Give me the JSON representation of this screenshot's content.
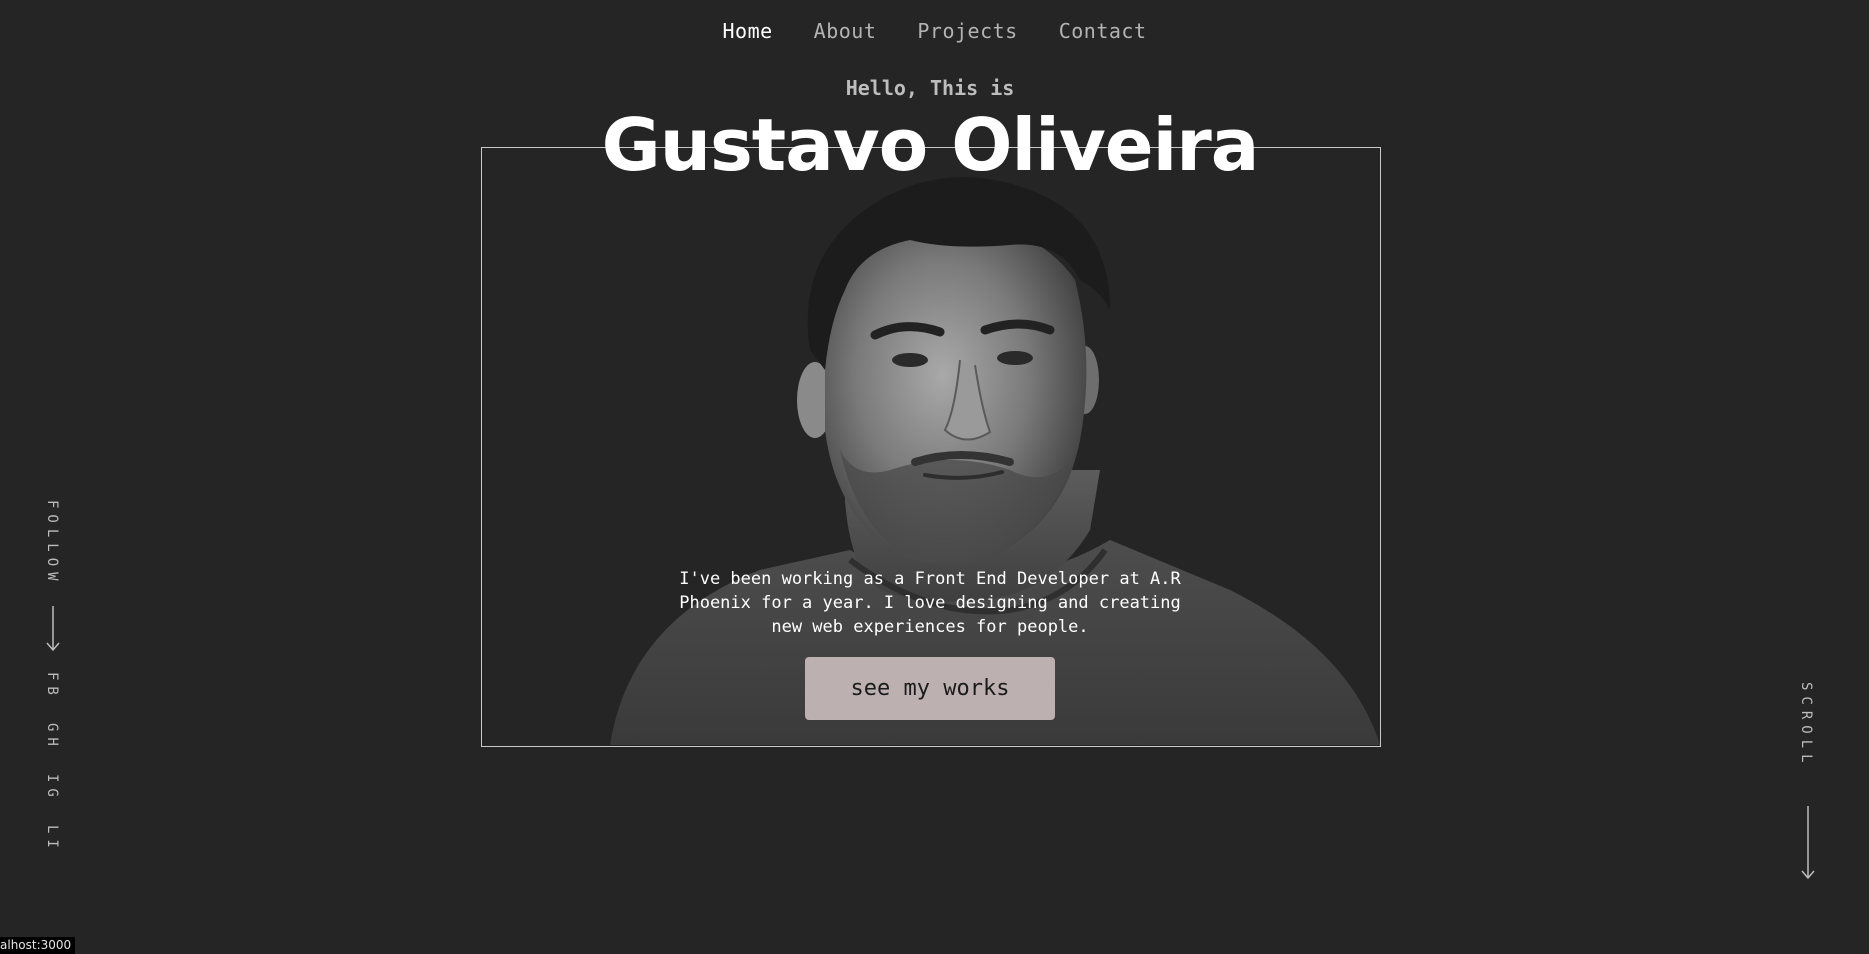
{
  "nav": {
    "items": [
      {
        "label": "Home",
        "active": true
      },
      {
        "label": "About",
        "active": false
      },
      {
        "label": "Projects",
        "active": false
      },
      {
        "label": "Contact",
        "active": false
      }
    ]
  },
  "hero": {
    "greeting": "Hello, This is",
    "name": "Gustavo Oliveira",
    "bio": "I've been working as a Front End Developer at A.R Phoenix for a year. I love designing and creating new web experiences for people.",
    "cta_label": "see my works"
  },
  "social": {
    "follow_label": "FOLLOW",
    "links": [
      "FB",
      "GH",
      "IG",
      "LI"
    ]
  },
  "scroll_label": "SCROLL",
  "status_text": "alhost:3000",
  "colors": {
    "background": "#252525",
    "text_primary": "#ffffff",
    "text_muted": "#bdbdbd",
    "button_bg": "#bcb0b0",
    "frame_border": "#c9c9c9"
  }
}
